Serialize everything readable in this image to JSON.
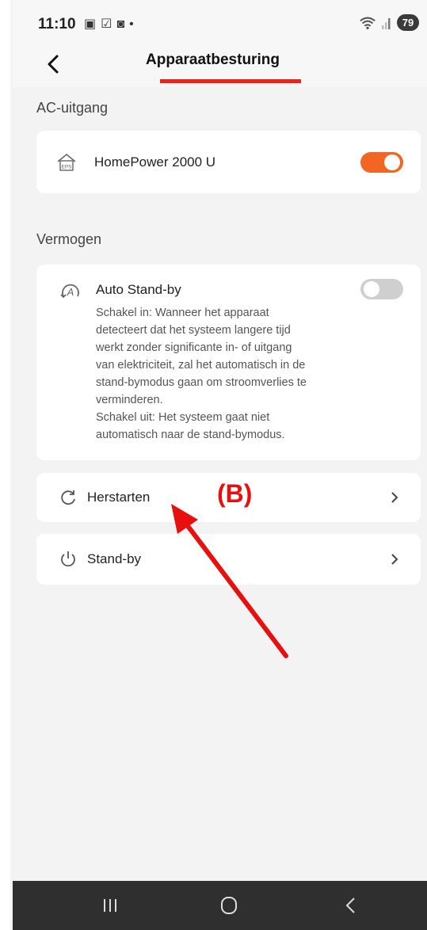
{
  "status_bar": {
    "time": "11:10",
    "left_icons": [
      "app-notification-icon",
      "checkbox-notification-icon",
      "bag-notification-icon",
      "dot-icon"
    ],
    "battery": "79"
  },
  "header": {
    "title": "Apparaatbesturing",
    "back_icon": "chevron-left-icon",
    "accent_color": "#e8241c"
  },
  "ac_section": {
    "label": "AC-uitgang",
    "device_icon": "eps-house-icon",
    "device_icon_text": "EPS",
    "device_name": "HomePower 2000 U",
    "toggle_on": true,
    "toggle_color": "#f26522"
  },
  "power_section": {
    "label": "Vermogen",
    "auto_standby": {
      "icon": "auto-a-icon",
      "icon_text": "A",
      "title": "Auto Stand-by",
      "toggle_on": false,
      "description": [
        "Schakel in: Wanneer het apparaat",
        "detecteert dat het systeem langere tijd",
        "werkt zonder significante in- of uitgang",
        "van elektriciteit, zal het automatisch in de",
        "stand-bymodus gaan om stroomverlies te",
        "verminderen.",
        "Schakel uit: Het systeem gaat niet",
        "automatisch naar de stand-bymodus."
      ]
    },
    "restart": {
      "icon": "restart-icon",
      "label": "Herstarten"
    },
    "standby": {
      "icon": "power-icon",
      "label": "Stand-by"
    }
  },
  "annotation": {
    "label": "(B)",
    "color": "#e8100e"
  },
  "nav_bar": {
    "buttons": [
      "recents-icon",
      "home-icon",
      "back-icon"
    ]
  }
}
